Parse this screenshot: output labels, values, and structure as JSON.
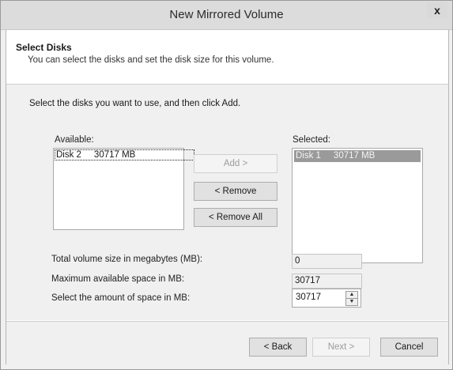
{
  "window": {
    "title": "New Mirrored Volume",
    "close_glyph": "x"
  },
  "header": {
    "title": "Select Disks",
    "subtitle": "You can select the disks and set the disk size for this volume."
  },
  "instructions": "Select the disks you want to use, and then click Add.",
  "available": {
    "label": "Available:",
    "items": [
      "Disk 2     30717 MB"
    ]
  },
  "selected": {
    "label": "Selected:",
    "items": [
      "Disk 1     30717 MB"
    ]
  },
  "buttons": {
    "add": "Add >",
    "remove": "< Remove",
    "remove_all": "< Remove All"
  },
  "fields": {
    "total_label": "Total volume size in megabytes (MB):",
    "total_value": "0",
    "max_label": "Maximum available space in MB:",
    "max_value": "30717",
    "amount_label": "Select the amount of space in MB:",
    "amount_value": "30717"
  },
  "footer": {
    "back": "< Back",
    "next": "Next >",
    "cancel": "Cancel"
  },
  "icons": {
    "spin_up": "chevron-up-icon",
    "spin_down": "chevron-down-icon",
    "close": "close-icon"
  }
}
